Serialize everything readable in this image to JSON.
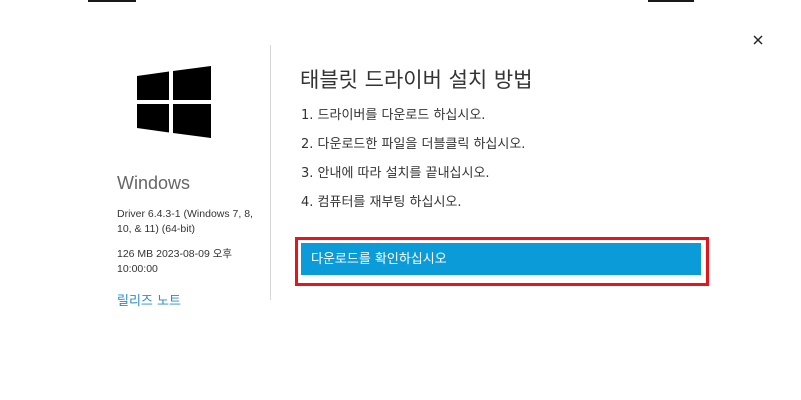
{
  "dialog": {
    "close_icon": "close-icon"
  },
  "left": {
    "logo_icon": "windows-logo-icon",
    "os_name": "Windows",
    "driver_info": "Driver 6.4.3-1 (Windows 7, 8, 10, & 11) (64-bit)",
    "size_info": "126 MB 2023-08-09 오후 10:00:00",
    "release_notes_link": "릴리즈 노트"
  },
  "main": {
    "title": "태블릿 드라이버 설치 방법",
    "steps": [
      "1. 드라이버를 다운로드 하십시오.",
      "2. 다운로드한 파일을 더블클릭 하십시오.",
      "3. 안내에 따라 설치를 끝내십시오.",
      "4. 컴퓨터를 재부팅 하십시오."
    ],
    "download_button_label": "다운로드를 확인하십시오"
  },
  "colors": {
    "accent_button": "#0b9bd8",
    "highlight_border": "#e8141b",
    "link": "#2a8dc9"
  }
}
